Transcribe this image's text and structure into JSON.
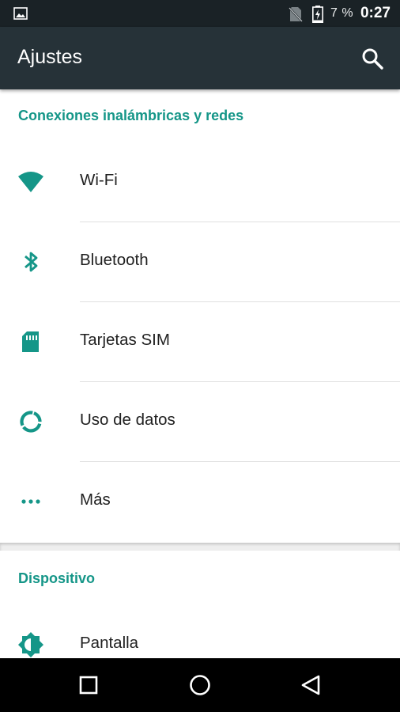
{
  "status_bar": {
    "battery_percent": "7 %",
    "time": "0:27",
    "icons": [
      "gallery-icon",
      "no-sim-icon",
      "battery-charging-icon"
    ]
  },
  "app_bar": {
    "title": "Ajustes",
    "search_icon": "search-icon"
  },
  "sections": [
    {
      "header": "Conexiones inalámbricas y redes",
      "items": [
        {
          "label": "Wi-Fi",
          "icon": "wifi-icon"
        },
        {
          "label": "Bluetooth",
          "icon": "bluetooth-icon"
        },
        {
          "label": "Tarjetas SIM",
          "icon": "sim-card-icon"
        },
        {
          "label": "Uso de datos",
          "icon": "data-usage-icon"
        },
        {
          "label": "Más",
          "icon": "more-icon"
        }
      ]
    },
    {
      "header": "Dispositivo",
      "items": [
        {
          "label": "Pantalla",
          "icon": "brightness-icon"
        }
      ]
    }
  ],
  "nav_bar": {
    "buttons": [
      "recents-icon",
      "home-icon",
      "back-icon"
    ]
  },
  "colors": {
    "accent": "#159688",
    "app_bar": "#263238",
    "status_bar": "#1a2226"
  }
}
